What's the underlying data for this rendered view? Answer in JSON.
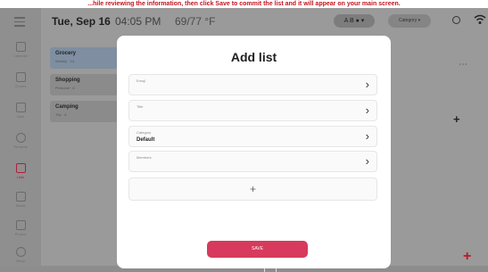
{
  "banner": {
    "text": "...hile reviewing the information, then click Save to commit the list and it will appear on your main screen."
  },
  "rail": {
    "items": [
      {
        "label": "Calendar",
        "icon": "calendar-icon",
        "active": false
      },
      {
        "label": "Chores",
        "icon": "chores-icon",
        "active": false
      },
      {
        "label": "Lists",
        "icon": "lists-icon",
        "active": false
      },
      {
        "label": "Rewards",
        "icon": "rewards-icon",
        "active": false
      },
      {
        "label": "Lists",
        "icon": "list-icon",
        "active": true
      },
      {
        "label": "Meals",
        "icon": "meals-icon",
        "active": false
      },
      {
        "label": "Photos",
        "icon": "photos-icon",
        "active": false
      },
      {
        "label": "Sleep",
        "icon": "sleep-icon",
        "active": false
      }
    ]
  },
  "header": {
    "date": "Tue, Sep 16",
    "time": "04:05 PM",
    "temperature": "69/77 °F",
    "avatars": "A B ● ▾",
    "category_button": "Category ▾"
  },
  "lists": [
    {
      "title": "Grocery",
      "subtitle": "Weekly · 14"
    },
    {
      "title": "Shopping",
      "subtitle": "Personal · 6"
    },
    {
      "title": "Camping",
      "subtitle": "Trip · 8"
    }
  ],
  "modal": {
    "title": "Add list",
    "fields": [
      {
        "label": "Emoji",
        "value": ""
      },
      {
        "label": "Title",
        "value": ""
      },
      {
        "label": "Category",
        "value": "Default"
      },
      {
        "label": "Members",
        "value": ""
      }
    ],
    "add_symbol": "+",
    "save_label": "SAVE"
  },
  "colors": {
    "accent": "#d73a5c",
    "active_nav": "#b01e3c",
    "fab": "#c0152a"
  }
}
